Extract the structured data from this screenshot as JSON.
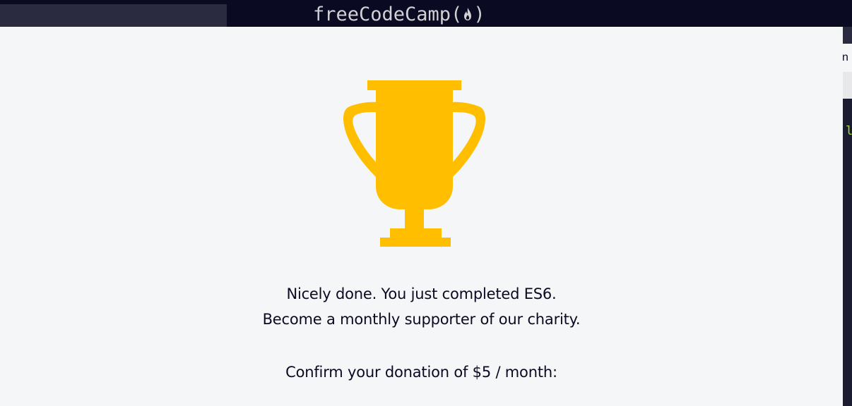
{
  "header": {
    "logo_text": "freeCodeCamp(",
    "logo_close": ")",
    "logo_icon": "flame-icon"
  },
  "background_editor": {
    "tab_partial": "n",
    "code_partial": "l"
  },
  "modal": {
    "trophy_icon": "trophy-icon",
    "trophy_color": "#ffbf00",
    "completion_text": "Nicely done. You just completed ES6.",
    "supporter_text": "Become a monthly supporter of our charity.",
    "confirm_text": "Confirm your donation of $5 / month:"
  }
}
